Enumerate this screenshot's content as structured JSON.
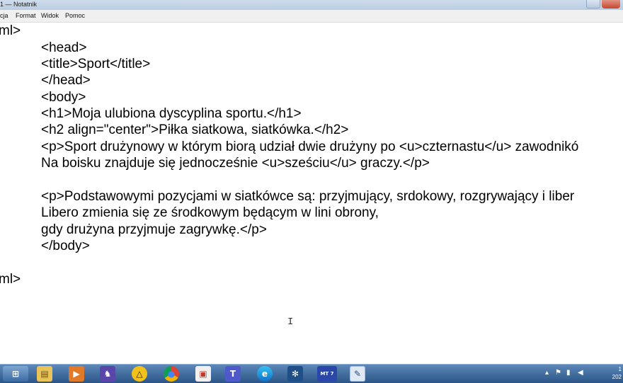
{
  "window": {
    "title": "1 — Notatnik"
  },
  "menu": [
    "cja",
    "Format",
    "Widok",
    "Pomoc"
  ],
  "editor": {
    "lines": [
      "ml>",
      "<head>",
      "<title>Sport</title>",
      "</head>",
      "<body>",
      "<h1>Moja ulubiona dyscyplina sportu.</h1>",
      "<h2 align=\"center\">Piłka siatkowa, siatkówka.</h2>",
      "<p>Sport drużynowy w którym biorą udział dwie drużyny po <u>czternastu</u> zawodnikó",
      "Na boisku znajduje się jednocześnie <u>sześciu</u> graczy.</p>",
      "",
      "<p>Podstawowymi pozycjami w siatkówce są: przyjmujący, srdokowy, rozgrywający i liber",
      "Libero zmienia się ze środkowym będącym w lini obrony,",
      "gdy drużyna przyjmuje zagrywkę.</p>",
      "</body>",
      "",
      "ml>"
    ],
    "cursor_glyph": "I"
  },
  "taskbar": {
    "apps": [
      {
        "icon": "start-orb-icon",
        "glyph": "⊞"
      },
      {
        "icon": "file-explorer-icon",
        "glyph": "▤"
      },
      {
        "icon": "media-player-icon",
        "glyph": "▶"
      },
      {
        "icon": "wizard-icon",
        "glyph": "♞"
      },
      {
        "icon": "warning-app-icon",
        "glyph": "△"
      },
      {
        "icon": "chrome-icon",
        "glyph": "●"
      },
      {
        "icon": "app-icon",
        "glyph": "▣"
      },
      {
        "icon": "teams-icon",
        "glyph": "T"
      },
      {
        "icon": "edge-icon",
        "glyph": "e"
      },
      {
        "icon": "snowflake-app-icon",
        "glyph": "✻"
      },
      {
        "icon": "mt7-icon",
        "glyph": "MT 7"
      },
      {
        "icon": "notepad-icon",
        "glyph": "✎"
      }
    ],
    "clock_line1": "1",
    "clock_line2": "202"
  },
  "colors": {
    "taskbar": "#2a5586",
    "titlebar": "#b9cde3"
  }
}
